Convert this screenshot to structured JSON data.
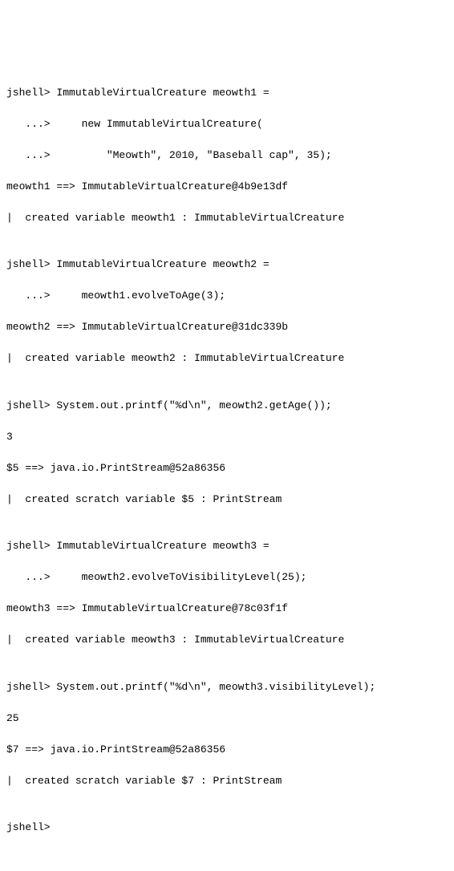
{
  "lines": {
    "l0": "jshell> ImmutableVirtualCreature meowth1 =",
    "l1": "   ...>     new ImmutableVirtualCreature(",
    "l2": "   ...>         \"Meowth\", 2010, \"Baseball cap\", 35);",
    "l3": "meowth1 ==> ImmutableVirtualCreature@4b9e13df",
    "l4": "|  created variable meowth1 : ImmutableVirtualCreature",
    "l5": "",
    "l6": "jshell> ImmutableVirtualCreature meowth2 =",
    "l7": "   ...>     meowth1.evolveToAge(3);",
    "l8": "meowth2 ==> ImmutableVirtualCreature@31dc339b",
    "l9": "|  created variable meowth2 : ImmutableVirtualCreature",
    "l10": "",
    "l11": "jshell> System.out.printf(\"%d\\n\", meowth2.getAge());",
    "l12": "3",
    "l13": "$5 ==> java.io.PrintStream@52a86356",
    "l14": "|  created scratch variable $5 : PrintStream",
    "l15": "",
    "l16": "jshell> ImmutableVirtualCreature meowth3 =",
    "l17": "   ...>     meowth2.evolveToVisibilityLevel(25);",
    "l18": "meowth3 ==> ImmutableVirtualCreature@78c03f1f",
    "l19": "|  created variable meowth3 : ImmutableVirtualCreature",
    "l20": "",
    "l21": "jshell> System.out.printf(\"%d\\n\", meowth3.visibilityLevel);",
    "l22": "25",
    "l23": "$7 ==> java.io.PrintStream@52a86356",
    "l24": "|  created scratch variable $7 : PrintStream",
    "l25": "",
    "l26": "jshell> "
  }
}
